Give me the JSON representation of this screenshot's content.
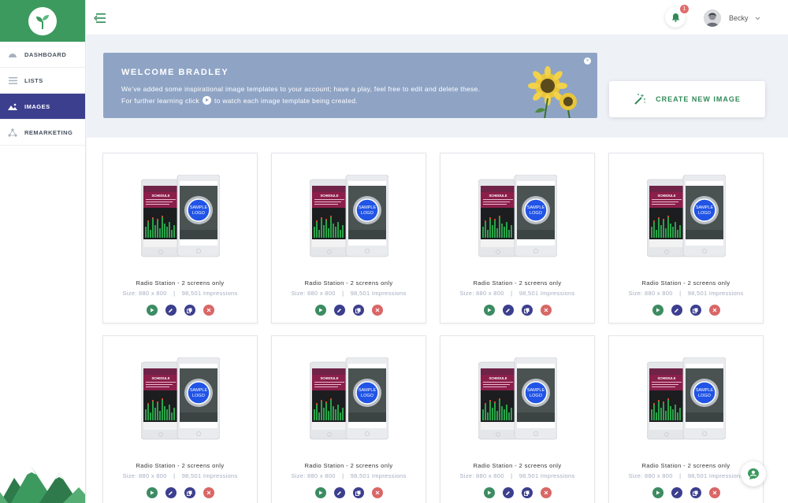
{
  "app": {
    "accent": "#3d9a5f",
    "nav_active": "#3c3f8e"
  },
  "sidebar": {
    "items": [
      {
        "label": "DASHBOARD",
        "icon": "dashboard-gauge-icon"
      },
      {
        "label": "LISTS",
        "icon": "list-lines-icon"
      },
      {
        "label": "IMAGES",
        "icon": "image-icon",
        "active": true
      },
      {
        "label": "REMARKETING",
        "icon": "remarketing-network-icon"
      }
    ]
  },
  "topbar": {
    "notification_count": "1",
    "user_name": "Becky"
  },
  "welcome": {
    "title": "WELCOME BRADLEY",
    "line1": "We’ve added some inspirational image templates to your account; have a play, feel free to edit and delete these.",
    "line2_before": "For further learning click",
    "line2_after": "to watch each image template being created."
  },
  "create_button": {
    "label": "CREATE NEW IMAGE"
  },
  "templates": [
    {
      "title": "Radio Station - 2 screens only",
      "size_label": "Size:",
      "size": "880 x 800",
      "impressions": "98,501 Impressions"
    },
    {
      "title": "Radio Station - 2 screens only",
      "size_label": "Size:",
      "size": "880 x 800",
      "impressions": "98,501 Impressions"
    },
    {
      "title": "Radio Station - 2 screens only",
      "size_label": "Size:",
      "size": "880 x 800",
      "impressions": "98,501 Impressions"
    },
    {
      "title": "Radio Station - 2 screens only",
      "size_label": "Size:",
      "size": "880 x 800",
      "impressions": "98,501 Impressions"
    },
    {
      "title": "Radio Station - 2 screens only",
      "size_label": "Size:",
      "size": "880 x 800",
      "impressions": "98,501 Impressions"
    },
    {
      "title": "Radio Station - 2 screens only",
      "size_label": "Size:",
      "size": "880 x 800",
      "impressions": "98,501 Impressions"
    },
    {
      "title": "Radio Station - 2 screens only",
      "size_label": "Size:",
      "size": "880 x 800",
      "impressions": "98,501 Impressions"
    },
    {
      "title": "Radio Station - 2 screens only",
      "size_label": "Size:",
      "size": "880 x 800",
      "impressions": "98,501 Impressions"
    }
  ],
  "thumbnail": {
    "schedule_label": "SCHEDULE",
    "logo_line1": "SAMPLE",
    "logo_line2": "LOGO"
  }
}
